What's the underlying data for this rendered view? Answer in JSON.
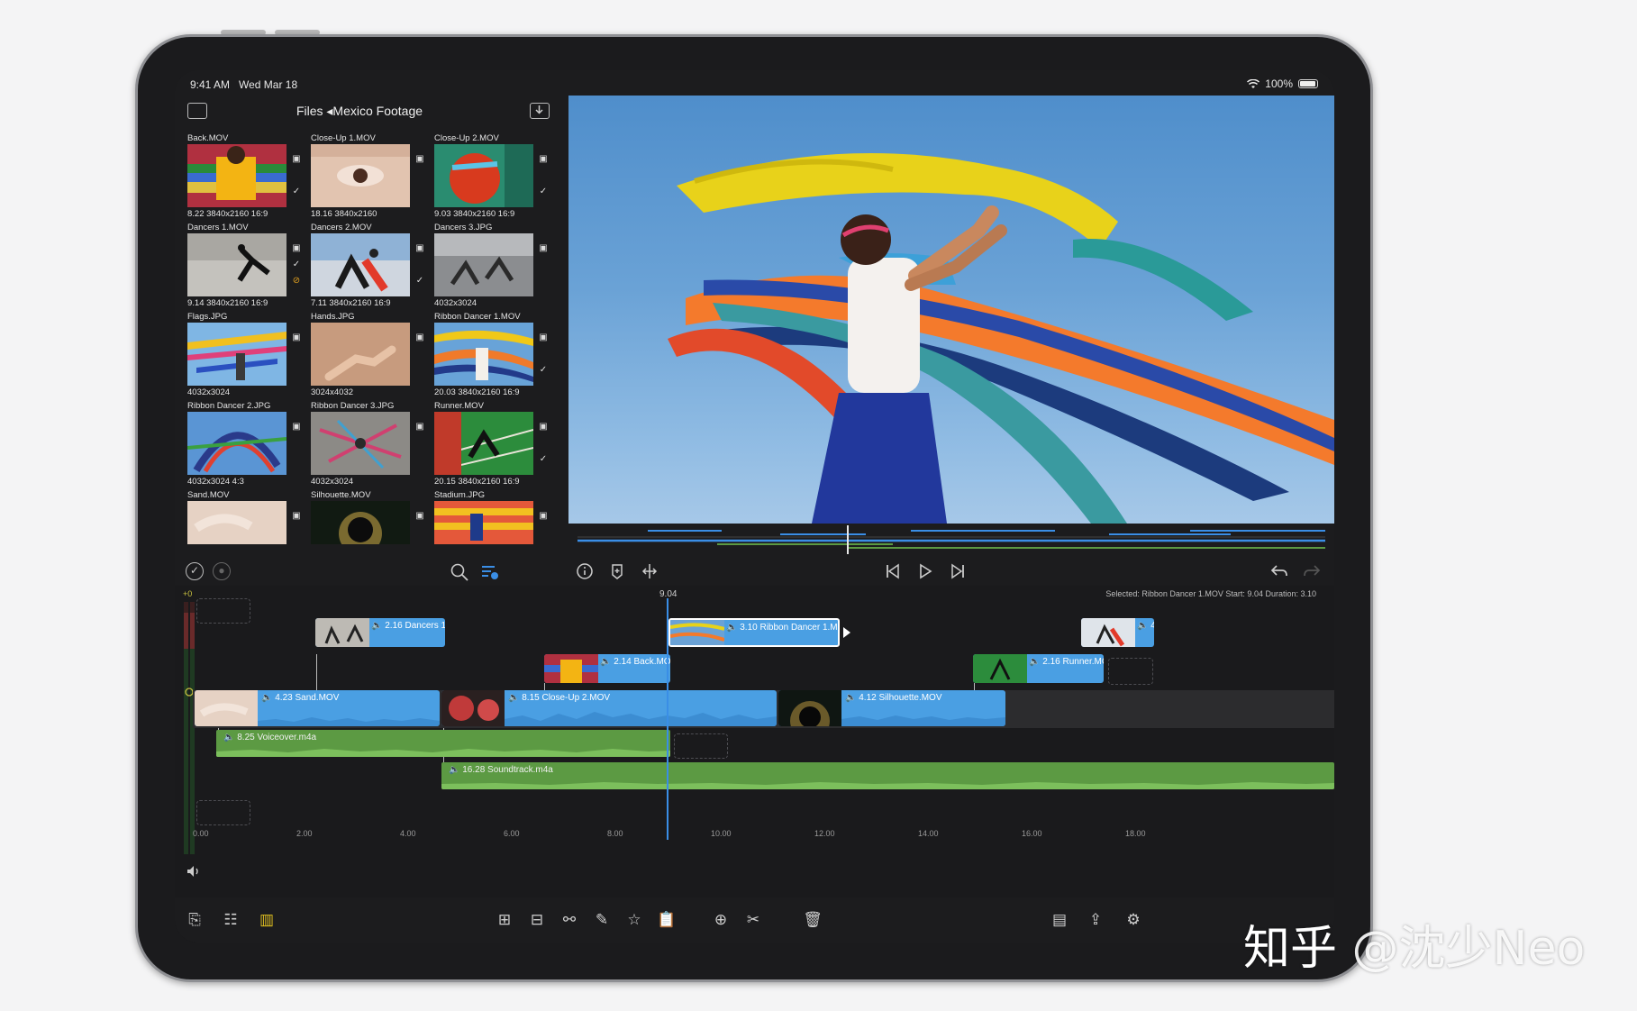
{
  "status_bar": {
    "time": "9:41 AM",
    "date": "Wed Mar 18",
    "battery": "100%"
  },
  "browser": {
    "title": "Files ◂Mexico Footage",
    "items": [
      {
        "name": "Back.MOV",
        "meta": "8.22  3840x2160  16:9"
      },
      {
        "name": "Close-Up 1.MOV",
        "meta": "18.16  3840x2160"
      },
      {
        "name": "Close-Up 2.MOV",
        "meta": "9.03  3840x2160  16:9"
      },
      {
        "name": "Dancers 1.MOV",
        "meta": "9.14  3840x2160  16:9"
      },
      {
        "name": "Dancers 2.MOV",
        "meta": "7.11  3840x2160  16:9"
      },
      {
        "name": "Dancers 3.JPG",
        "meta": "4032x3024"
      },
      {
        "name": "Flags.JPG",
        "meta": "4032x3024"
      },
      {
        "name": "Hands.JPG",
        "meta": "3024x4032"
      },
      {
        "name": "Ribbon Dancer 1.MOV",
        "meta": "20.03  3840x2160  16:9"
      },
      {
        "name": "Ribbon Dancer 2.JPG",
        "meta": "4032x3024  4:3"
      },
      {
        "name": "Ribbon Dancer 3.JPG",
        "meta": "4032x3024"
      },
      {
        "name": "Runner.MOV",
        "meta": "20.15  3840x2160  16:9"
      },
      {
        "name": "Sand.MOV",
        "meta": ""
      },
      {
        "name": "Silhouette.MOV",
        "meta": ""
      },
      {
        "name": "Stadium.JPG",
        "meta": ""
      }
    ]
  },
  "timeline": {
    "playhead_time": "9.04",
    "selection_info": "Selected: Ribbon Dancer 1.MOV Start: 9.04 Duration: 3.10",
    "meter_label": "+0",
    "ruler": [
      "0.00",
      "2.00",
      "4.00",
      "6.00",
      "8.00",
      "10.00",
      "12.00",
      "14.00",
      "16.00",
      "18.00"
    ],
    "clips": {
      "dancers": "🔈 2.16  Dancers 1",
      "ribbon": "🔈 3.10  Ribbon Dancer 1.MC",
      "back": "🔈 2.14  Back.MOV",
      "runner": "🔈 2.16  Runner.MC",
      "edge": "🔈 4",
      "sand": "🔈 4.23  Sand.MOV",
      "closeup": "🔈 8.15  Close-Up 2.MOV",
      "silhouette": "🔈 4.12  Silhouette.MOV",
      "voiceover": "🔈 8.25  Voiceover.m4a",
      "soundtrack": "🔈 16.28  Soundtrack.m4a"
    }
  },
  "watermark": {
    "brand": "知乎",
    "handle": "@沈少Neo"
  },
  "colors": {
    "accent": "#3a8ee6",
    "video_clip": "#4a9fe3",
    "audio_clip": "#5c9a43"
  }
}
